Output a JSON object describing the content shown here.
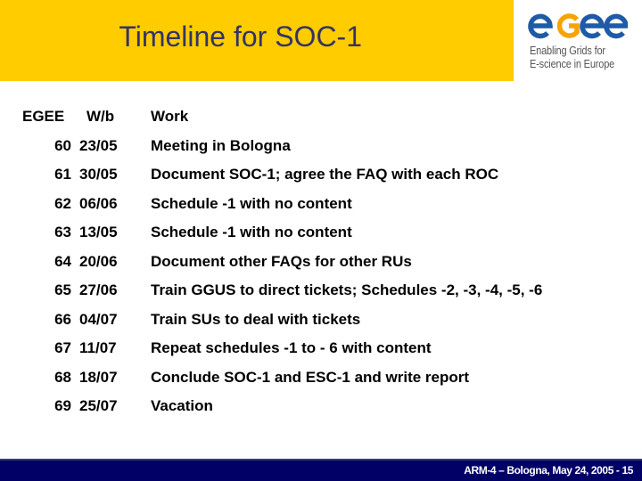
{
  "slide": {
    "title": "Timeline for SOC-1"
  },
  "logo": {
    "wordmark": "egee",
    "tagline_line1": "Enabling Grids for",
    "tagline_line2": "E-science in Europe",
    "colors": {
      "blue": "#1f5aa6",
      "orange": "#f5a400"
    }
  },
  "colors": {
    "header_band": "#ffcc00",
    "title_text": "#333366",
    "footer_bar": "#000066"
  },
  "table": {
    "headers": {
      "egee": "EGEE",
      "wb": "W/b",
      "work": "Work"
    },
    "rows": [
      {
        "egee": "60",
        "wb": "23/05",
        "work": "Meeting in Bologna"
      },
      {
        "egee": "61",
        "wb": "30/05",
        "work": "Document SOC-1; agree the FAQ with each ROC"
      },
      {
        "egee": "62",
        "wb": "06/06",
        "work": "Schedule -1 with no content"
      },
      {
        "egee": "63",
        "wb": "13/05",
        "work": "Schedule -1 with no content"
      },
      {
        "egee": "64",
        "wb": "20/06",
        "work": "Document other FAQs for other RUs"
      },
      {
        "egee": "65",
        "wb": "27/06",
        "work": "Train GGUS to direct tickets; Schedules -2, -3, -4, -5, -6"
      },
      {
        "egee": "66",
        "wb": "04/07",
        "work": "Train SUs to deal with tickets"
      },
      {
        "egee": "67",
        "wb": "11/07",
        "work": "Repeat schedules -1 to - 6 with content"
      },
      {
        "egee": "68",
        "wb": "18/07",
        "work": "Conclude SOC-1 and ESC-1 and write report"
      },
      {
        "egee": "69",
        "wb": "25/07",
        "work": "Vacation"
      }
    ]
  },
  "footer": {
    "text": "ARM-4 – Bologna, May 24, 2005  -  15"
  }
}
